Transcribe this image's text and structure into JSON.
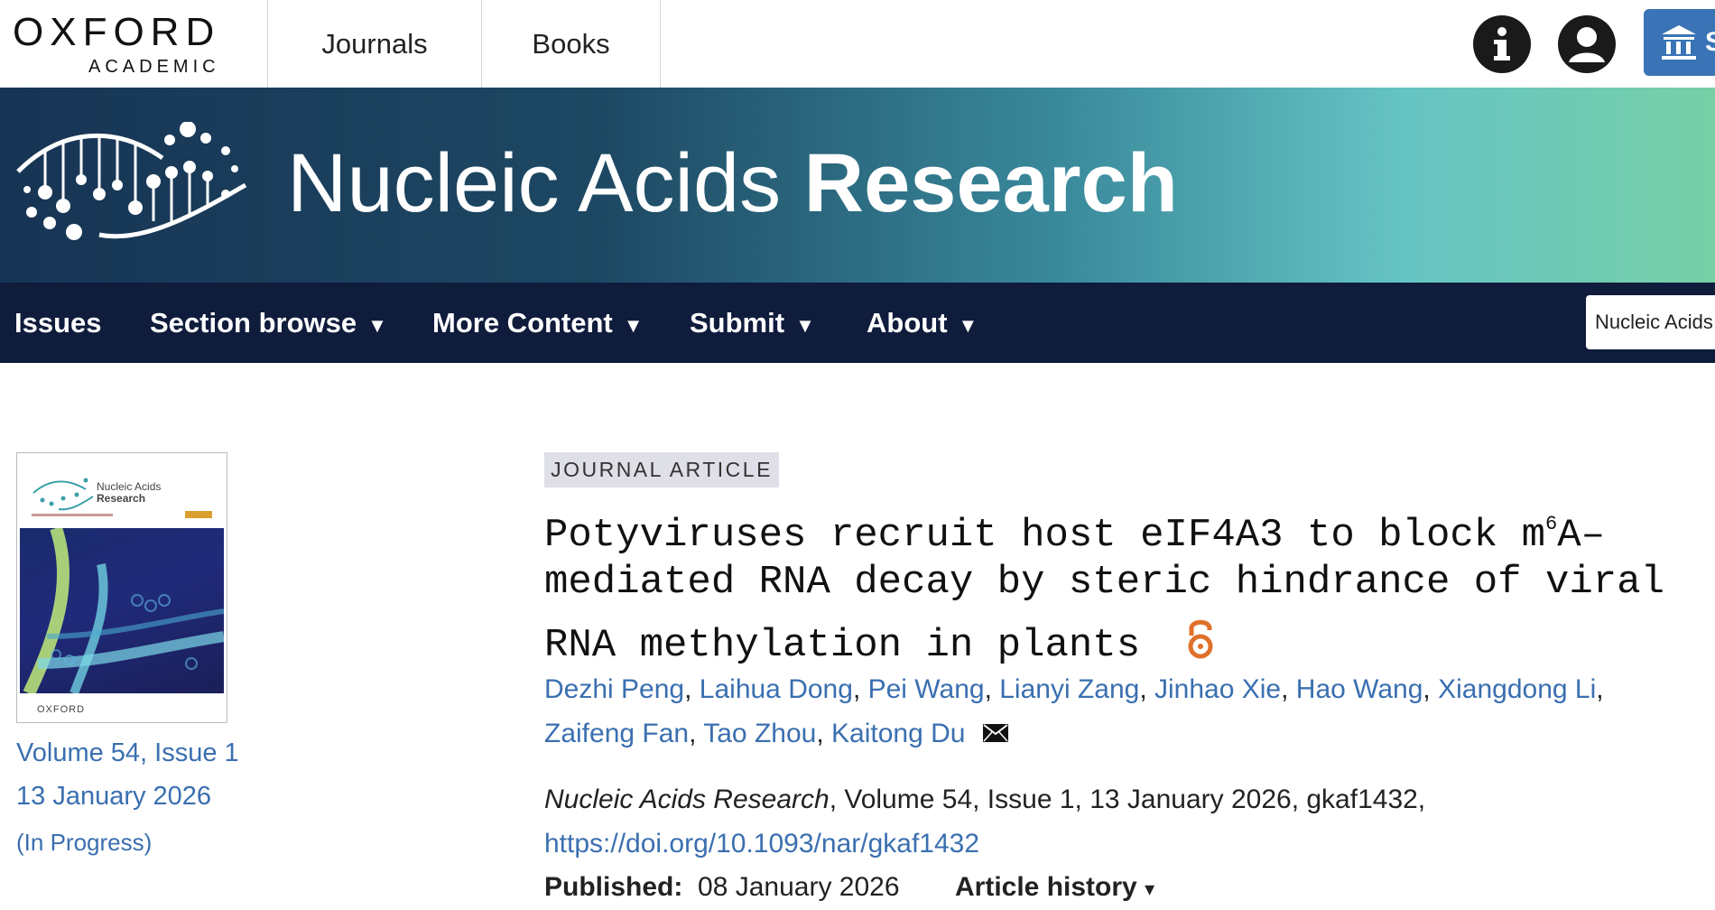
{
  "header": {
    "logo_line1": "OXFORD",
    "logo_line2": "ACADEMIC",
    "nav": [
      "Journals",
      "Books"
    ],
    "info_icon": "info-icon",
    "account_icon": "account-icon",
    "institution_icon": "institution-icon",
    "institution_label": "S"
  },
  "banner": {
    "title_light": "Nucleic Acids ",
    "title_bold": "Research",
    "gradient": [
      "#173454",
      "#3a8a9c",
      "#77cfa6"
    ]
  },
  "nav": {
    "items": [
      {
        "label": "Issues",
        "caret": ""
      },
      {
        "label": "Section browse",
        "caret": "▼"
      },
      {
        "label": "More Content",
        "caret": "▼"
      },
      {
        "label": "Submit",
        "caret": "▼"
      },
      {
        "label": "About",
        "caret": "▼"
      }
    ],
    "search_scope": "Nucleic Acids"
  },
  "sidebar": {
    "cover": {
      "title_line1": "Nucleic Acids",
      "title_line2": "Research",
      "publisher": "OXFORD"
    },
    "volume_issue": "Volume 54, Issue 1",
    "issue_date": "13 January 2026",
    "status": "(In Progress)"
  },
  "article": {
    "type_badge": "JOURNAL ARTICLE",
    "title_line1_a": "Potyviruses recruit host eIF4A3 to block m",
    "title_line1_sup": "6",
    "title_line1_b": "A–",
    "title_line2": "mediated RNA decay by steric hindrance of viral",
    "title_line3": "RNA methylation in plants",
    "open_access_icon": "open-access-icon",
    "authors": [
      "Dezhi Peng",
      "Laihua Dong",
      "Pei Wang",
      "Lianyi Zang",
      "Jinhao Xie",
      "Hao Wang",
      "Xiangdong Li",
      "Zaifeng Fan",
      "Tao Zhou",
      "Kaitong Du"
    ],
    "author_sep": ", ",
    "author_line1_end": ",",
    "email_icon": "envelope-icon",
    "journal": "Nucleic Acids Research",
    "citation_rest": ", Volume 54, Issue 1, 13 January 2026, gkaf1432,",
    "doi": "https://doi.org/10.1093/nar/gkaf1432",
    "published_label": "Published:",
    "published_date": "08 January 2026",
    "history_label": "Article history",
    "history_caret": "▾"
  },
  "colors": {
    "link": "#3a6fb0",
    "nav_bg": "#0f1c3c",
    "badge_bg": "#dedfe7",
    "open_access": "#e0702a",
    "institution_btn": "#3a74b6"
  }
}
